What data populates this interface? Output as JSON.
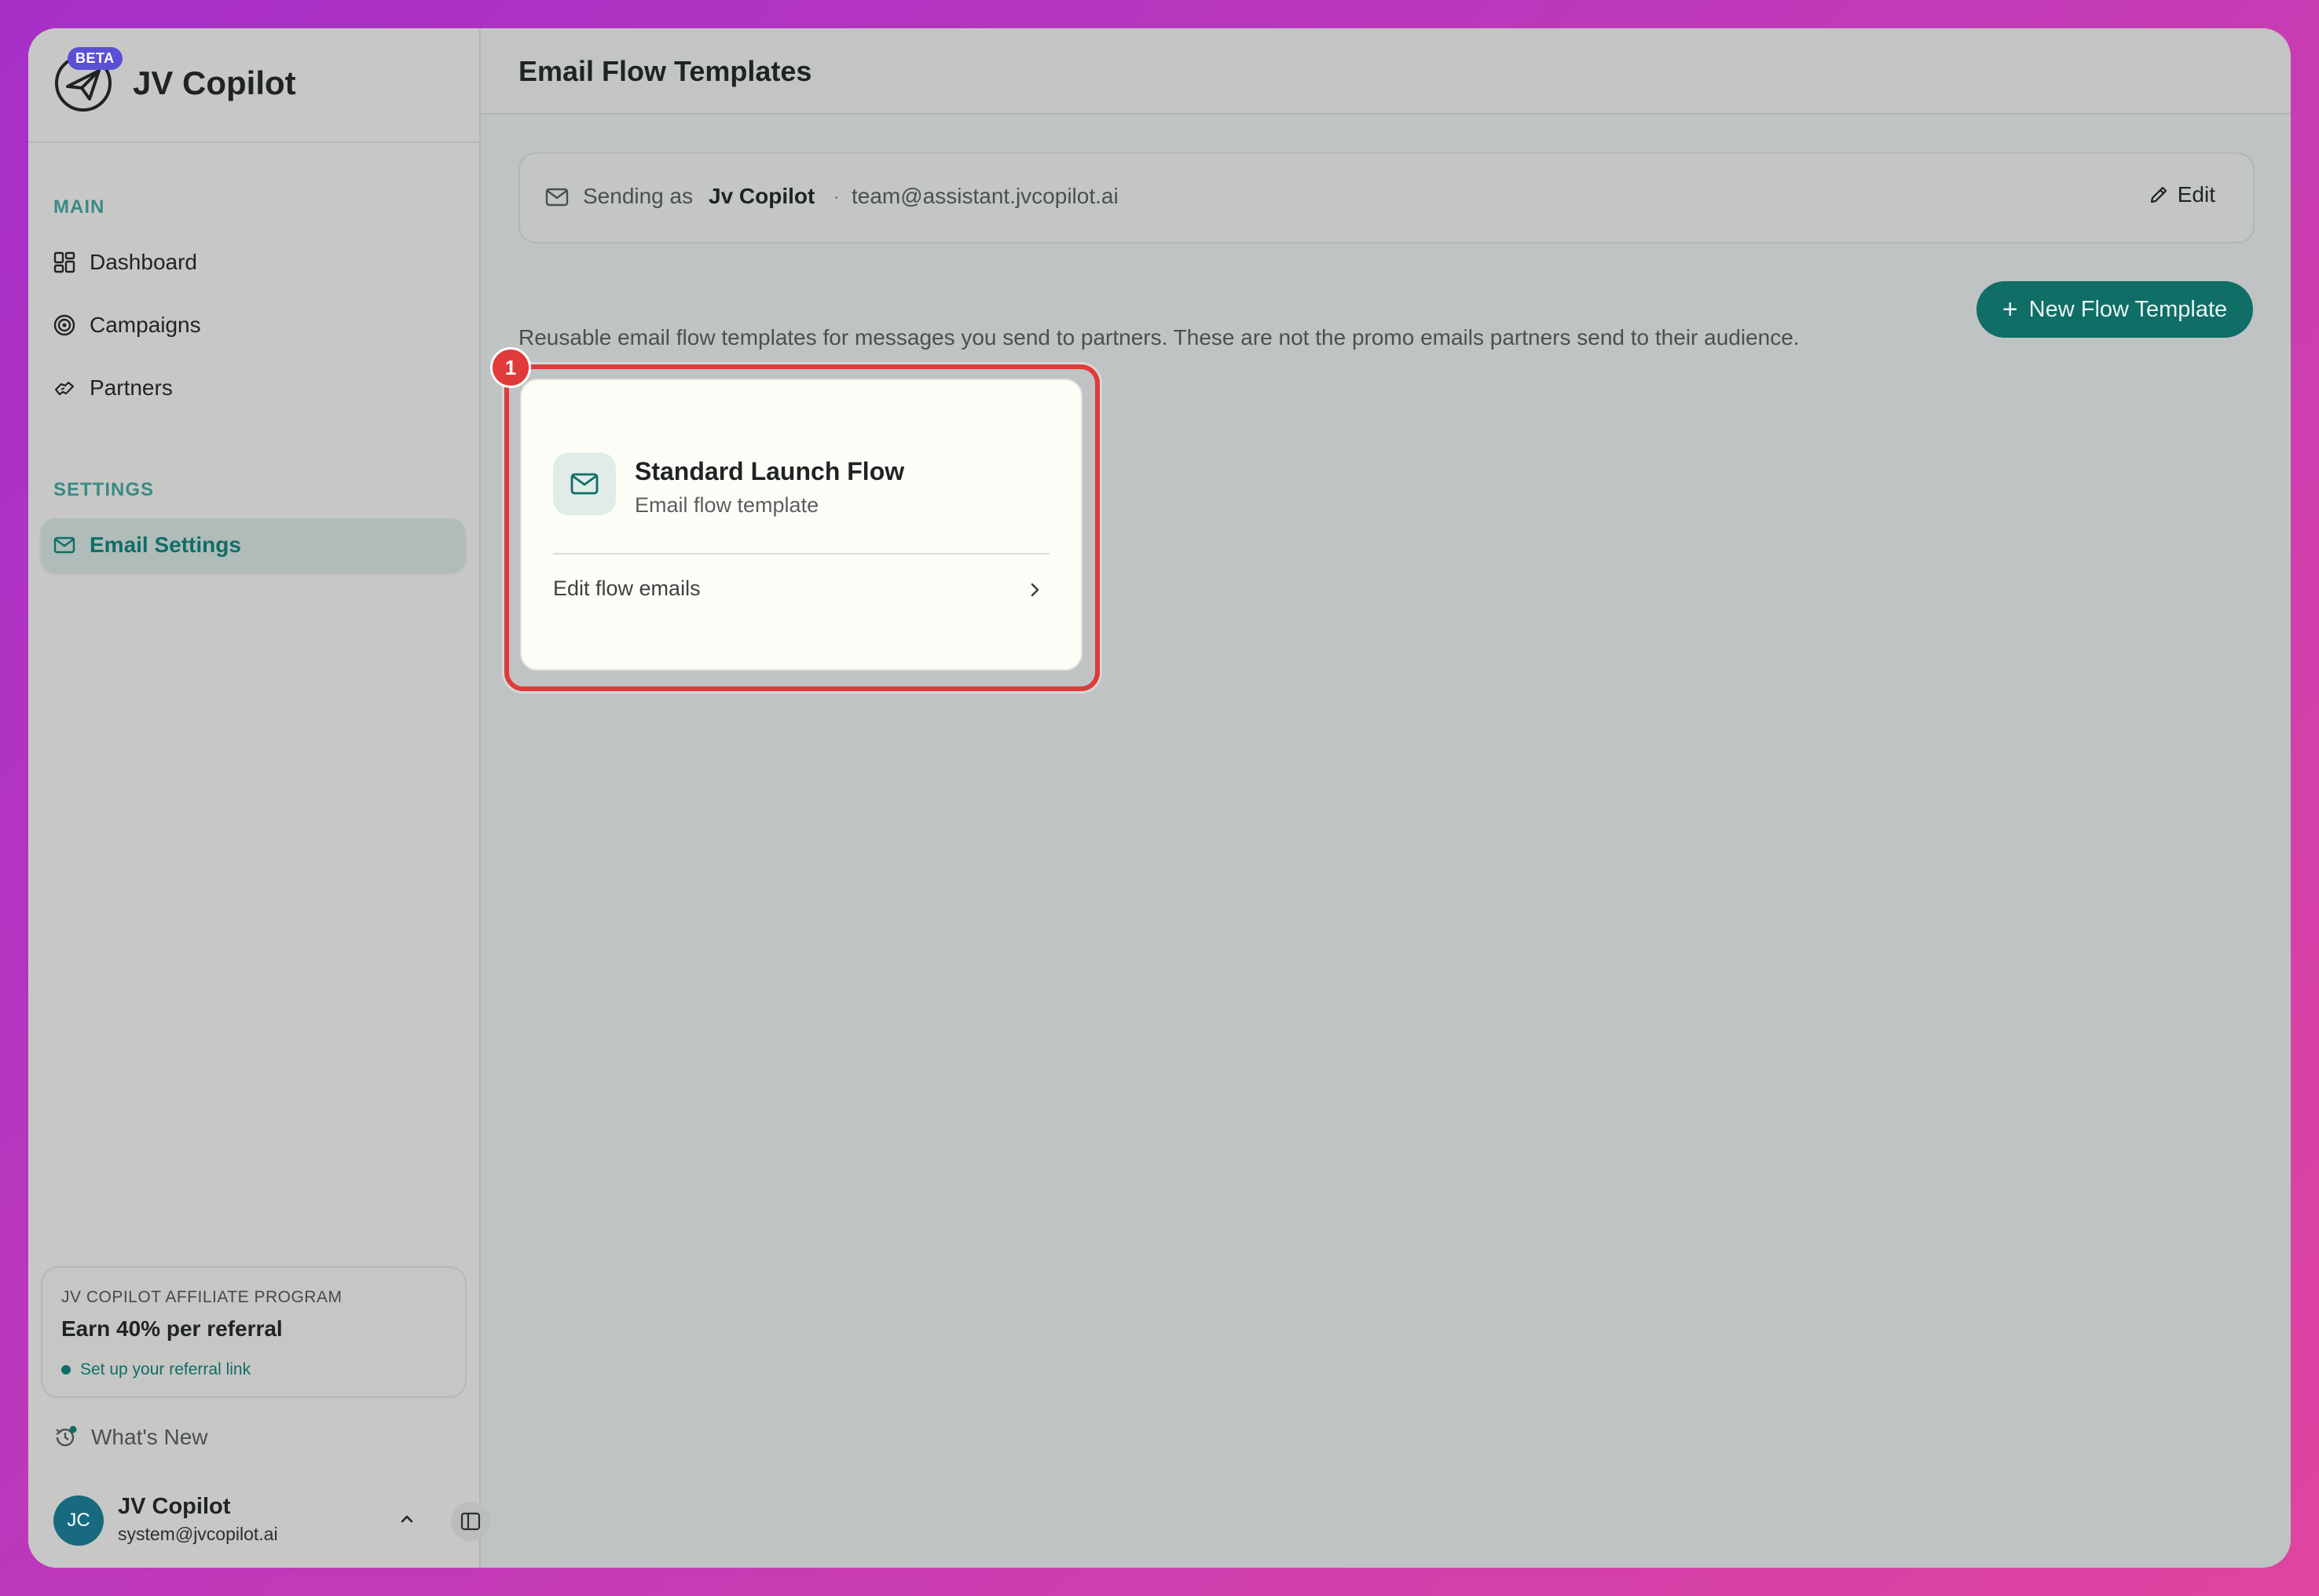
{
  "app": {
    "name": "JV Copilot",
    "badge": "BETA"
  },
  "sidebar": {
    "sections": {
      "main_label": "MAIN",
      "settings_label": "SETTINGS"
    },
    "items": [
      {
        "label": "Dashboard",
        "icon": "dashboard-icon"
      },
      {
        "label": "Campaigns",
        "icon": "target-icon"
      },
      {
        "label": "Partners",
        "icon": "handshake-icon"
      },
      {
        "label": "Email Settings",
        "icon": "mail-icon",
        "active": true
      }
    ],
    "affiliate": {
      "title": "JV COPILOT AFFILIATE PROGRAM",
      "headline": "Earn 40% per referral",
      "link": "Set up your referral link"
    },
    "whats_new": "What's New",
    "user": {
      "initials": "JC",
      "name": "JV Copilot",
      "email": "system@jvcopilot.ai"
    }
  },
  "header": {
    "title": "Email Flow Templates"
  },
  "sender": {
    "prefix": "Sending as",
    "name": "Jv Copilot",
    "separator": "·",
    "email": "team@assistant.jvcopilot.ai",
    "edit_label": "Edit"
  },
  "main": {
    "description": "Reusable email flow templates for messages you send to partners. These are not the promo emails partners send to their audience.",
    "new_button": "New Flow Template",
    "annotation_number": "1",
    "cards": [
      {
        "title": "Standard Launch Flow",
        "subtitle": "Email flow template",
        "link": "Edit flow emails"
      }
    ]
  },
  "colors": {
    "accent": "#0f6e66",
    "highlight": "#e03a3a",
    "beta": "#5b4fd6"
  }
}
